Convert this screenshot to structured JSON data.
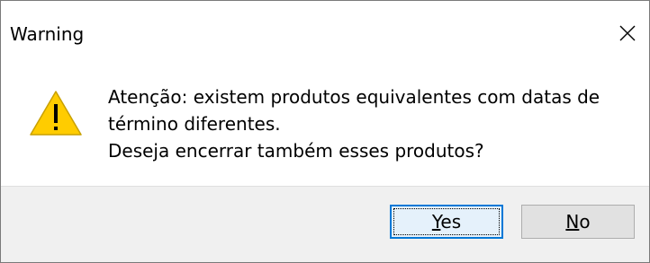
{
  "window": {
    "title": "Warning"
  },
  "icons": {
    "close": "close-icon",
    "warning": "warning-triangle-icon"
  },
  "message": {
    "line1": "Atenção: existem produtos equivalentes com datas de",
    "line2": "término diferentes.",
    "line3": "Deseja encerrar também esses produtos?"
  },
  "buttons": {
    "yes": {
      "mnemonic": "Y",
      "rest": "es",
      "is_default": true
    },
    "no": {
      "mnemonic": "N",
      "rest": "o"
    }
  },
  "colors": {
    "warning_fill": "#ffcc00",
    "warning_glyph": "#000000",
    "footer_bg": "#f0f0f0",
    "default_button_border": "#0078d7"
  }
}
